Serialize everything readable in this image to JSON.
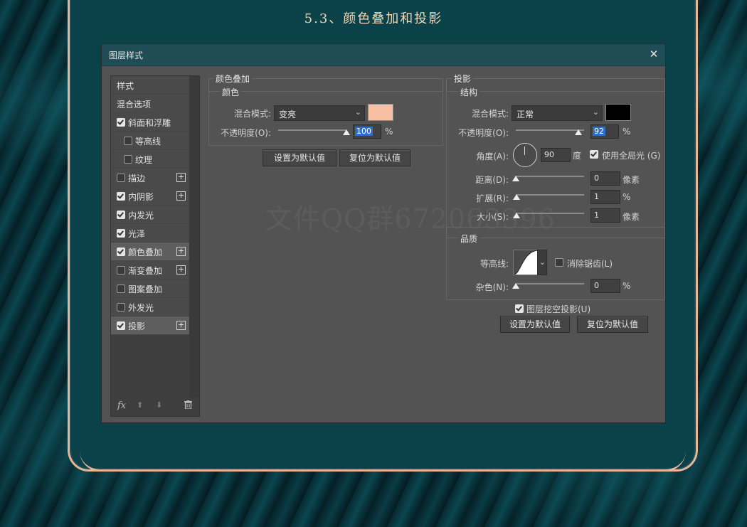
{
  "page": {
    "heading": "5.3、颜色叠加和投影",
    "watermark": "文件QQ群672063396"
  },
  "dialog": {
    "title": "图层样式",
    "close_glyph": "✕"
  },
  "sidebar": {
    "items": [
      {
        "label": "样式",
        "checkbox": false,
        "checked": false,
        "plus": false,
        "indent": false,
        "selected": false
      },
      {
        "label": "混合选项",
        "checkbox": false,
        "checked": false,
        "plus": false,
        "indent": false,
        "selected": false
      },
      {
        "label": "斜面和浮雕",
        "checkbox": true,
        "checked": true,
        "plus": false,
        "indent": false,
        "selected": false
      },
      {
        "label": "等高线",
        "checkbox": true,
        "checked": false,
        "plus": false,
        "indent": true,
        "selected": false
      },
      {
        "label": "纹理",
        "checkbox": true,
        "checked": false,
        "plus": false,
        "indent": true,
        "selected": false
      },
      {
        "label": "描边",
        "checkbox": true,
        "checked": false,
        "plus": true,
        "indent": false,
        "selected": false
      },
      {
        "label": "内阴影",
        "checkbox": true,
        "checked": true,
        "plus": true,
        "indent": false,
        "selected": false
      },
      {
        "label": "内发光",
        "checkbox": true,
        "checked": true,
        "plus": false,
        "indent": false,
        "selected": false
      },
      {
        "label": "光泽",
        "checkbox": true,
        "checked": true,
        "plus": false,
        "indent": false,
        "selected": false
      },
      {
        "label": "颜色叠加",
        "checkbox": true,
        "checked": true,
        "plus": true,
        "indent": false,
        "selected": true
      },
      {
        "label": "渐变叠加",
        "checkbox": true,
        "checked": false,
        "plus": true,
        "indent": false,
        "selected": false
      },
      {
        "label": "图案叠加",
        "checkbox": true,
        "checked": false,
        "plus": false,
        "indent": false,
        "selected": false
      },
      {
        "label": "外发光",
        "checkbox": true,
        "checked": false,
        "plus": false,
        "indent": false,
        "selected": false
      },
      {
        "label": "投影",
        "checkbox": true,
        "checked": true,
        "plus": true,
        "indent": false,
        "selected": true
      }
    ],
    "plus_glyph": "+",
    "footer": {
      "fx": "fx",
      "up": "⬆",
      "down": "⬇",
      "trash": "🗑"
    }
  },
  "color_overlay": {
    "section_title": "颜色叠加",
    "group_title": "颜色",
    "blend_label": "混合模式:",
    "blend_value": "变亮",
    "chevron": "⌄",
    "swatch_color": "#f7c0a3",
    "opacity_label": "不透明度(O):",
    "opacity_value": "100",
    "opacity_fraction": 1.0,
    "percent": "%",
    "set_default": "设置为默认值",
    "reset_default": "复位为默认值"
  },
  "drop_shadow": {
    "section_title": "投影",
    "structure_title": "结构",
    "blend_label": "混合模式:",
    "blend_value": "正常",
    "chevron": "⌄",
    "swatch_color": "#000000",
    "opacity_label": "不透明度(O):",
    "opacity_value": "92",
    "opacity_fraction": 0.92,
    "percent": "%",
    "angle_label": "角度(A):",
    "angle_value": "90",
    "angle_unit": "度",
    "global_light_label": "使用全局光 (G)",
    "distance_label": "距离(D):",
    "distance_value": "0",
    "distance_unit": "像素",
    "spread_label": "扩展(R):",
    "spread_value": "1",
    "spread_unit": "%",
    "size_label": "大小(S):",
    "size_value": "1",
    "size_unit": "像素",
    "quality_title": "品质",
    "contour_label": "等高线:",
    "antialias_label": "消除锯齿(L)",
    "noise_label": "杂色(N):",
    "noise_value": "0",
    "noise_unit": "%",
    "knockout_label": "图层挖空投影(U)",
    "set_default": "设置为默认值",
    "reset_default": "复位为默认值"
  }
}
